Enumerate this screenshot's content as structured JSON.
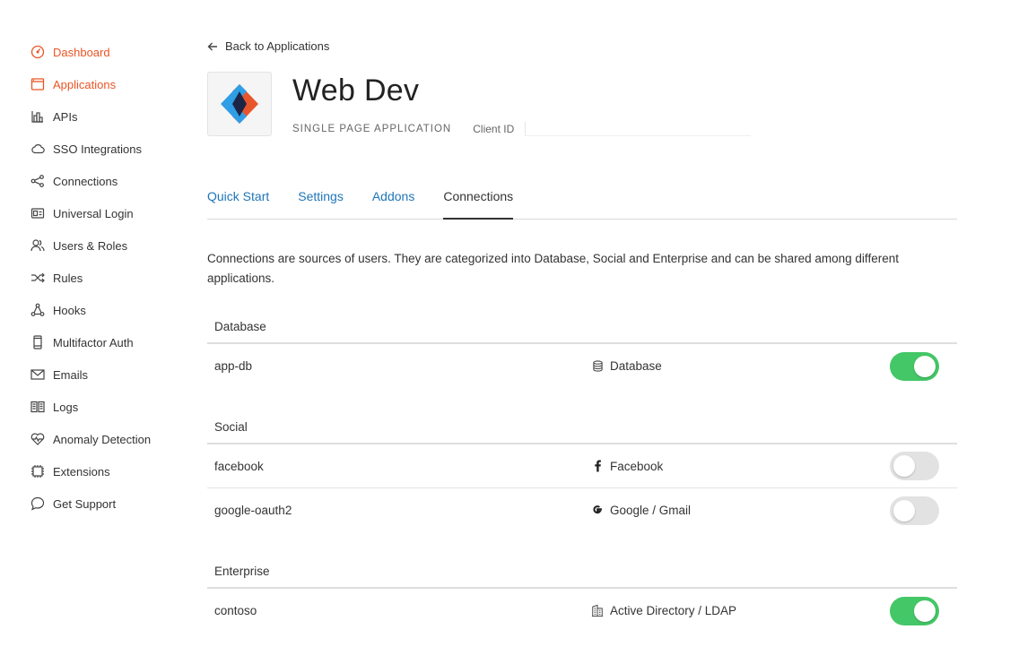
{
  "sidebar": {
    "items": [
      {
        "label": "Dashboard",
        "icon": "dashboard-icon",
        "active": true
      },
      {
        "label": "Applications",
        "icon": "applications-icon",
        "active": true
      },
      {
        "label": "APIs",
        "icon": "apis-icon",
        "active": false
      },
      {
        "label": "SSO Integrations",
        "icon": "cloud-icon",
        "active": false
      },
      {
        "label": "Connections",
        "icon": "connections-icon",
        "active": false
      },
      {
        "label": "Universal Login",
        "icon": "universal-login-icon",
        "active": false
      },
      {
        "label": "Users & Roles",
        "icon": "users-icon",
        "active": false
      },
      {
        "label": "Rules",
        "icon": "rules-icon",
        "active": false
      },
      {
        "label": "Hooks",
        "icon": "hooks-icon",
        "active": false
      },
      {
        "label": "Multifactor Auth",
        "icon": "phone-icon",
        "active": false
      },
      {
        "label": "Emails",
        "icon": "mail-icon",
        "active": false
      },
      {
        "label": "Logs",
        "icon": "logs-icon",
        "active": false
      },
      {
        "label": "Anomaly Detection",
        "icon": "heart-pulse-icon",
        "active": false
      },
      {
        "label": "Extensions",
        "icon": "chip-icon",
        "active": false
      },
      {
        "label": "Get Support",
        "icon": "chat-bubble-icon",
        "active": false
      }
    ],
    "accent_color": "#eb5424"
  },
  "header": {
    "back_label": "Back to Applications",
    "app_title": "Web Dev",
    "app_type": "SINGLE PAGE APPLICATION",
    "client_id_label": "Client ID"
  },
  "tabs": [
    {
      "label": "Quick Start",
      "active": false
    },
    {
      "label": "Settings",
      "active": false
    },
    {
      "label": "Addons",
      "active": false
    },
    {
      "label": "Connections",
      "active": true
    }
  ],
  "description": "Connections are sources of users. They are categorized into Database, Social and Enterprise and can be shared among different applications.",
  "groups": {
    "database": {
      "title": "Database",
      "rows": [
        {
          "name": "app-db",
          "type": "Database",
          "icon": "database-icon",
          "enabled": true
        }
      ]
    },
    "social": {
      "title": "Social",
      "rows": [
        {
          "name": "facebook",
          "type": "Facebook",
          "icon": "facebook-icon",
          "enabled": false
        },
        {
          "name": "google-oauth2",
          "type": "Google / Gmail",
          "icon": "google-icon",
          "enabled": false
        }
      ]
    },
    "enterprise": {
      "title": "Enterprise",
      "rows": [
        {
          "name": "contoso",
          "type": "Active Directory / LDAP",
          "icon": "building-icon",
          "enabled": true
        }
      ]
    }
  },
  "colors": {
    "toggle_on": "#44c767",
    "toggle_off": "#e2e2e2",
    "link": "#1e76b8"
  }
}
